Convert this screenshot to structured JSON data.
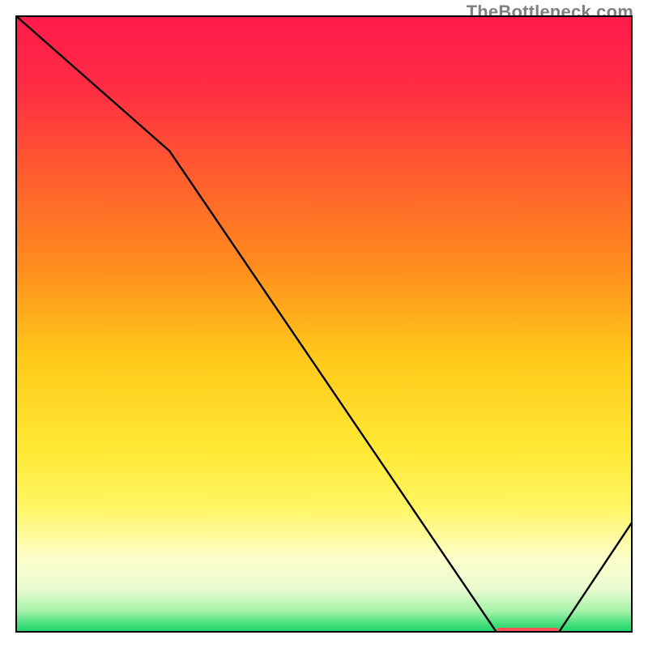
{
  "watermark": "TheBottleneck.com",
  "chart_data": {
    "type": "line",
    "title": "",
    "xlabel": "",
    "ylabel": "",
    "xlim": [
      0,
      100
    ],
    "ylim": [
      0,
      100
    ],
    "x": [
      0,
      25,
      78,
      88,
      100
    ],
    "values": [
      100,
      78,
      0,
      0,
      18
    ],
    "background_gradient_stops": [
      {
        "offset": 0.0,
        "color": "#ff1a4b"
      },
      {
        "offset": 0.12,
        "color": "#ff2d44"
      },
      {
        "offset": 0.25,
        "color": "#ff5a2f"
      },
      {
        "offset": 0.4,
        "color": "#ff8a1e"
      },
      {
        "offset": 0.55,
        "color": "#ffc81a"
      },
      {
        "offset": 0.7,
        "color": "#ffe833"
      },
      {
        "offset": 0.8,
        "color": "#fff666"
      },
      {
        "offset": 0.88,
        "color": "#fdfecb"
      },
      {
        "offset": 0.93,
        "color": "#e9fbd0"
      },
      {
        "offset": 0.965,
        "color": "#a6f2aa"
      },
      {
        "offset": 0.985,
        "color": "#4be07e"
      },
      {
        "offset": 1.0,
        "color": "#17d36a"
      }
    ],
    "optimal_marker": {
      "x_start": 78,
      "x_end": 88,
      "y": 0,
      "color": "#ff5252"
    }
  }
}
